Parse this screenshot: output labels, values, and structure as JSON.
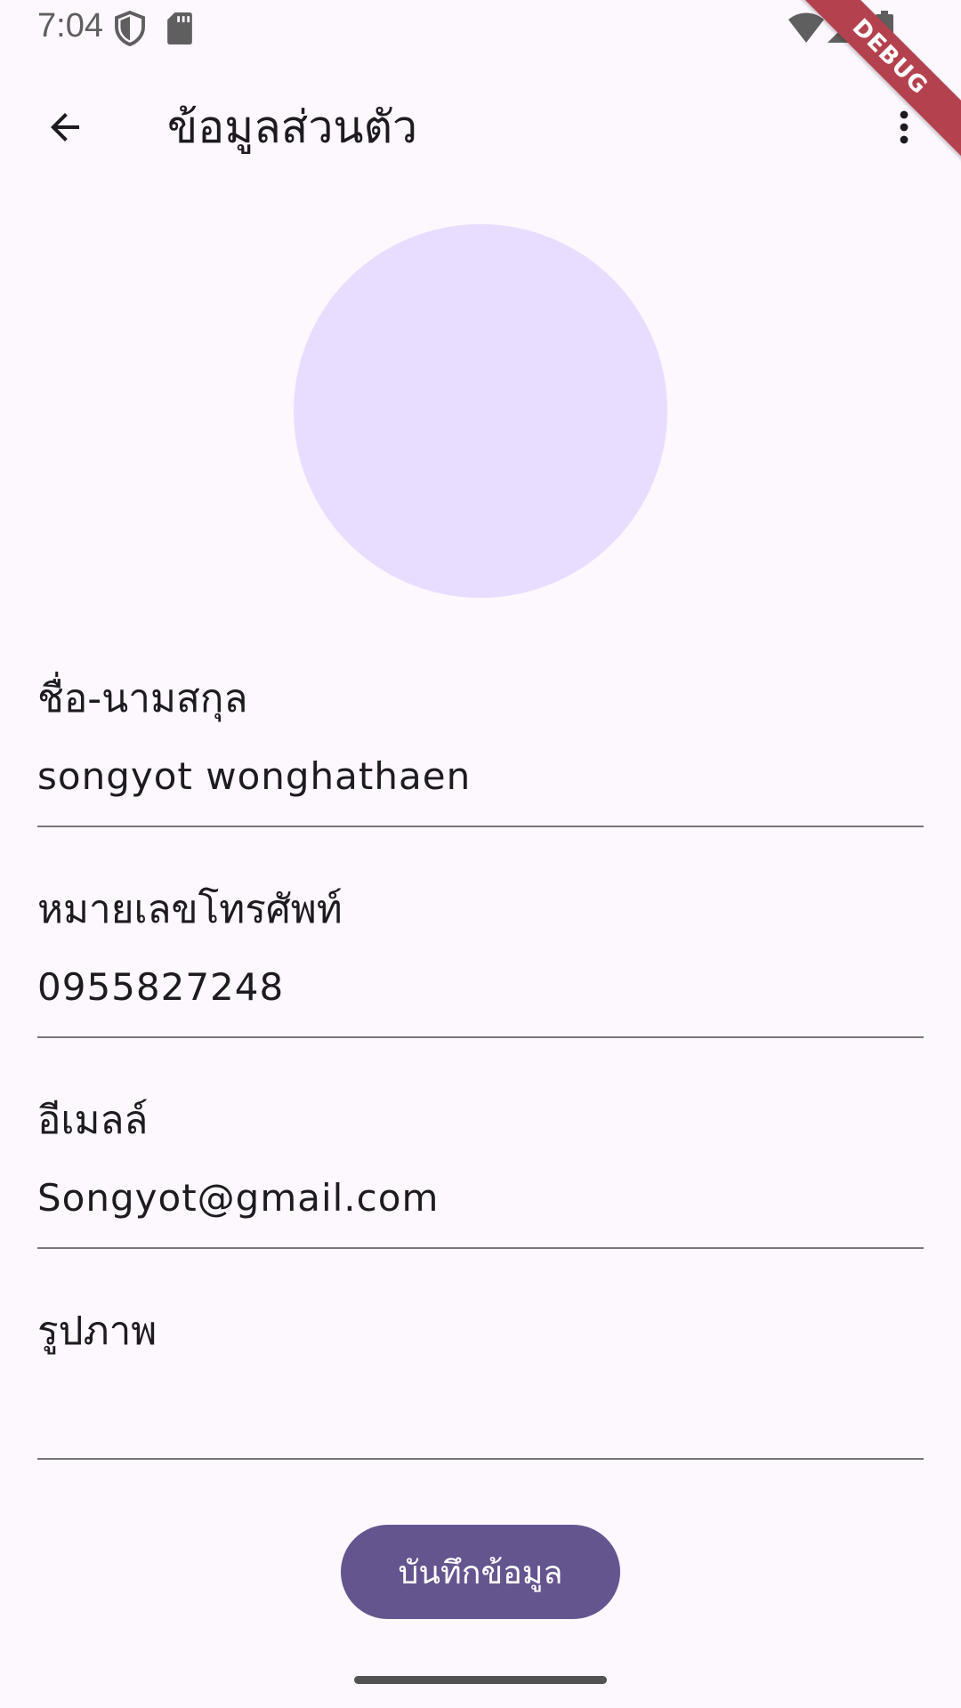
{
  "status_bar": {
    "time": "7:04",
    "icons": [
      "shield-icon",
      "sd-card-icon",
      "wifi-icon",
      "signal-icon",
      "battery-icon"
    ],
    "debug_banner": "DEBUG"
  },
  "app_bar": {
    "title": "ข้อมูลส่วนตัว",
    "back_icon": "arrow-back-icon",
    "menu_icon": "more-vert-icon"
  },
  "profile": {
    "avatar_color": "#e9ddff"
  },
  "form": {
    "name": {
      "label": "ชื่อ-นามสกุล",
      "value": "songyot wonghathaen"
    },
    "phone": {
      "label": "หมายเลขโทรศัพท์",
      "value": "0955827248"
    },
    "email": {
      "label": "อีเมลล์",
      "value": "Songyot@gmail.com"
    },
    "image": {
      "label": "รูปภาพ",
      "value": ""
    }
  },
  "actions": {
    "save_label": "บันทึกข้อมูล"
  },
  "colors": {
    "background": "#fdf7fe",
    "primary": "#65558f",
    "avatar": "#e9ddff",
    "debug": "#b4424e"
  }
}
